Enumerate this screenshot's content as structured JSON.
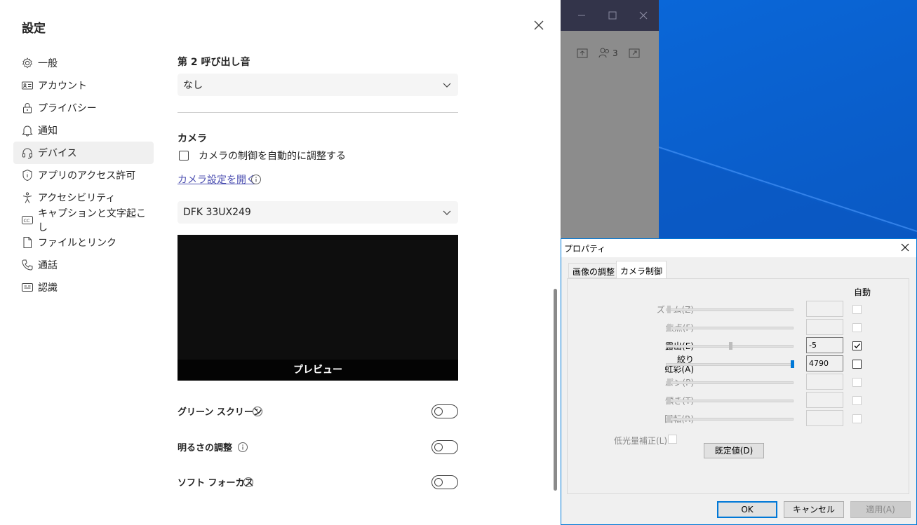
{
  "settings": {
    "title": "設定",
    "nav": [
      {
        "label": "一般",
        "icon": "gear-icon"
      },
      {
        "label": "アカウント",
        "icon": "id-card-icon"
      },
      {
        "label": "プライバシー",
        "icon": "lock-icon"
      },
      {
        "label": "通知",
        "icon": "bell-icon"
      },
      {
        "label": "デバイス",
        "icon": "headset-icon",
        "active": true
      },
      {
        "label": "アプリのアクセス許可",
        "icon": "shield-icon"
      },
      {
        "label": "アクセシビリティ",
        "icon": "accessibility-icon"
      },
      {
        "label": "キャプションと文字起こし",
        "icon": "closed-caption-icon"
      },
      {
        "label": "ファイルとリンク",
        "icon": "file-icon"
      },
      {
        "label": "通話",
        "icon": "phone-icon"
      },
      {
        "label": "認識",
        "icon": "recognition-icon"
      }
    ],
    "second_ringtone": {
      "label": "第 2 呼び出し音",
      "value": "なし"
    },
    "camera": {
      "label": "カメラ",
      "auto_adjust_label": "カメラの制御を自動的に調整する",
      "auto_adjust_checked": false,
      "open_settings_link": "カメラ設定を開く",
      "device": "DFK 33UX249",
      "preview_label": "プレビュー"
    },
    "toggles": [
      {
        "label": "グリーン スクリーン",
        "on": false
      },
      {
        "label": "明るさの調整",
        "on": false
      },
      {
        "label": "ソフト フォーカス",
        "on": false
      }
    ]
  },
  "teams_window": {
    "participant_count": "3"
  },
  "properties": {
    "title": "プロパティ",
    "tabs": [
      "画像の調整",
      "カメラ制御"
    ],
    "active_tab": 1,
    "auto_header": "自動",
    "controls": [
      {
        "label": "ズーム(Z)",
        "enabled": false,
        "value": "",
        "auto": false,
        "level": 0.0
      },
      {
        "label": "焦点(F)",
        "enabled": false,
        "value": "",
        "auto": false,
        "level": 0.0
      },
      {
        "label": "露出(E)",
        "enabled": true,
        "value": "-5",
        "auto": true,
        "level": 0.5
      },
      {
        "label": "絞り\n虹彩(A)",
        "enabled": true,
        "value": "4790",
        "auto": false,
        "level": 1.0
      },
      {
        "label": "パン(P)",
        "enabled": false,
        "value": "",
        "auto": false,
        "level": 0.0
      },
      {
        "label": "傾き(T)",
        "enabled": false,
        "value": "",
        "auto": false,
        "level": 0.0
      },
      {
        "label": "回転(R)",
        "enabled": false,
        "value": "",
        "auto": false,
        "level": 0.0
      }
    ],
    "low_light_label": "低光量補正(L)",
    "default_button": "既定値(D)",
    "ok": "OK",
    "cancel": "キャンセル",
    "apply": "適用(A)"
  },
  "colors": {
    "accent": "#4f52b2",
    "dialog_focus": "#0078d7",
    "desktop": "#0a5cc8"
  }
}
